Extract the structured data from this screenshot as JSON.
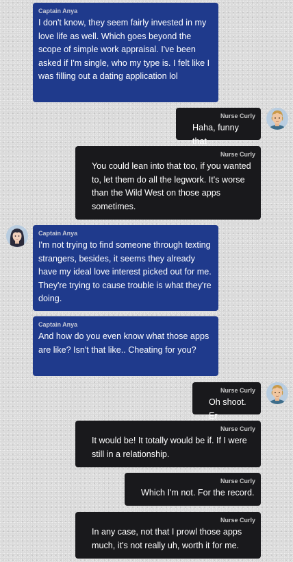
{
  "messages": [
    {
      "sender": "Captain Anya",
      "text": "I don't know, they seem fairly invested in my love life as well. Which goes beyond the scope of simple work appraisal. I've been asked if I'm single, who my type is. I felt like I was filling out a dating application lol"
    },
    {
      "sender": "Nurse Curly",
      "text": "Haha, funny that"
    },
    {
      "sender": "Nurse Curly",
      "text": "You could lean into that too, if you wanted to, let them do all the legwork. It's worse than the Wild West on those apps sometimes."
    },
    {
      "sender": "Captain Anya",
      "text": "I'm not trying to find someone through texting strangers, besides, it seems they already have my ideal love interest picked out for me. They're trying to cause trouble is what they're doing."
    },
    {
      "sender": "Captain Anya",
      "text": "And how do you even know what those apps are like? Isn't that like.. Cheating for you?"
    },
    {
      "sender": "Nurse Curly",
      "text": "Oh shoot. Er"
    },
    {
      "sender": "Nurse Curly",
      "text": "It would be! It totally would be if. If I were still in a relationship."
    },
    {
      "sender": "Nurse Curly",
      "text": "Which I'm not. For the record."
    },
    {
      "sender": "Nurse Curly",
      "text": "In any case, not that I prowl those apps much, it's not really uh, worth it for me."
    }
  ],
  "avatars": {
    "curly": "nurse-curly-avatar",
    "anya": "captain-anya-avatar"
  },
  "colors": {
    "anya_bubble": "#1f3a8c",
    "curly_bubble": "#19191c",
    "background": "#d9d9d9"
  }
}
